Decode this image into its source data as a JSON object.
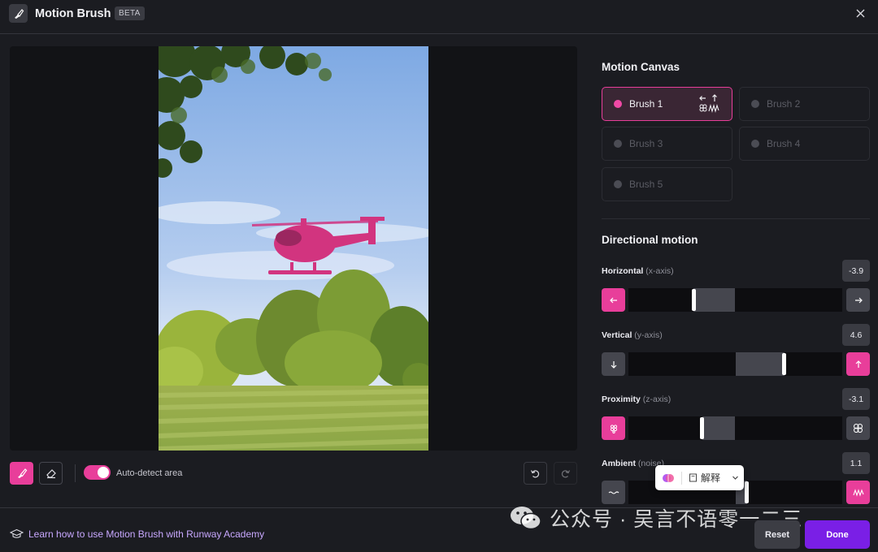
{
  "header": {
    "title": "Motion Brush",
    "badge": "BETA"
  },
  "canvas": {
    "toggle_label": "Auto-detect area",
    "toggle_on": true
  },
  "panel": {
    "motion_canvas_title": "Motion Canvas",
    "brushes": [
      {
        "label": "Brush 1",
        "active": true
      },
      {
        "label": "Brush 2",
        "active": false
      },
      {
        "label": "Brush 3",
        "active": false
      },
      {
        "label": "Brush 4",
        "active": false
      },
      {
        "label": "Brush 5",
        "active": false
      }
    ],
    "directional_title": "Directional motion",
    "axes": [
      {
        "label": "Horizontal",
        "sub": "(x-axis)",
        "value": "-3.9",
        "number": -3.9
      },
      {
        "label": "Vertical",
        "sub": "(y-axis)",
        "value": "4.6",
        "number": 4.6
      },
      {
        "label": "Proximity",
        "sub": "(z-axis)",
        "value": "-3.1",
        "number": -3.1
      },
      {
        "label": "Ambient",
        "sub": "(noise)",
        "value": "1.1",
        "number": 1.1
      }
    ]
  },
  "popup": {
    "explain_label": "解释"
  },
  "footer": {
    "academy_link": "Learn how to use Motion Brush with Runway Academy",
    "reset_label": "Reset",
    "done_label": "Done"
  },
  "watermark": {
    "text": "公众号 · 吴言不语零一二三"
  },
  "colors": {
    "accent_pink": "#e83e9a",
    "done_purple": "#7a1fe6",
    "background": "#1b1c21"
  }
}
